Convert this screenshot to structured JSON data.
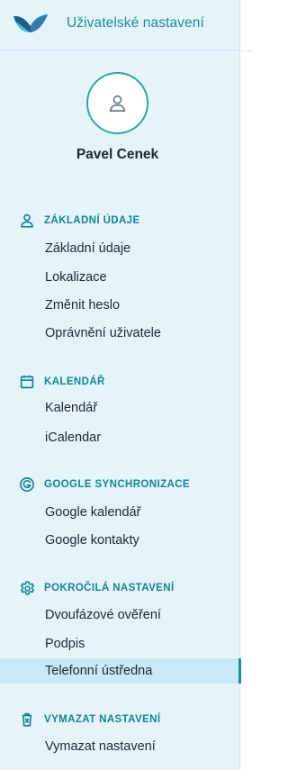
{
  "header": {
    "title": "Uživatelské nastavení"
  },
  "user": {
    "name": "Pavel Cenek"
  },
  "sections": [
    {
      "id": "basic",
      "label": "ZÁKLADNÍ ÚDAJE",
      "icon": "person-icon",
      "items": [
        "Základní údaje",
        "Lokalizace",
        "Změnit heslo",
        "Oprávnění uživatele"
      ]
    },
    {
      "id": "calendar",
      "label": "KALENDÁŘ",
      "icon": "calendar-icon",
      "items": [
        "Kalendář",
        "iCalendar"
      ]
    },
    {
      "id": "google",
      "label": "GOOGLE SYNCHRONIZACE",
      "icon": "google-icon",
      "items": [
        "Google kalendář",
        "Google kontakty"
      ]
    },
    {
      "id": "advanced",
      "label": "POKROČILÁ NASTAVENÍ",
      "icon": "gear-icon",
      "items": [
        "Dvoufázové ověření",
        "Podpis",
        "Telefonní ústředna"
      ]
    },
    {
      "id": "delete",
      "label": "VYMAZAT NASTAVENÍ",
      "icon": "trash-icon",
      "items": [
        "Vymazat nastavení"
      ]
    }
  ],
  "active_item": "Telefonní ústředna",
  "colors": {
    "accent": "#1a8e9b",
    "sidebar_bg": "#e5f4fb",
    "active_bg": "#c9e9f6",
    "text": "#1d2733"
  }
}
